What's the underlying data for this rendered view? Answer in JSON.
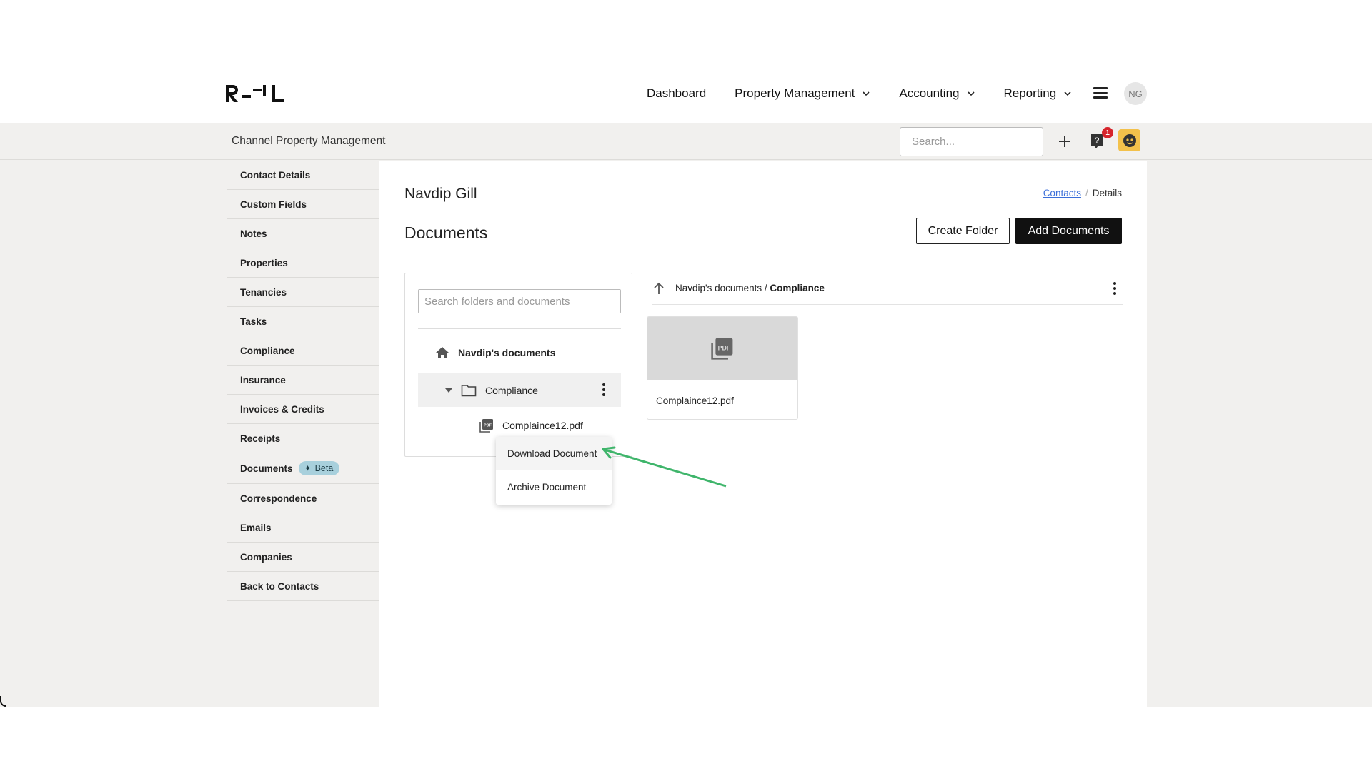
{
  "nav": {
    "links": [
      "Dashboard",
      "Property Management",
      "Accounting",
      "Reporting"
    ],
    "avatar_initials": "NG"
  },
  "subbar": {
    "company": "Channel Property Management",
    "search_placeholder": "Search...",
    "help_badge_count": "1"
  },
  "sidebar": {
    "items": [
      {
        "label": "Contact Details"
      },
      {
        "label": "Custom Fields"
      },
      {
        "label": "Notes"
      },
      {
        "label": "Properties"
      },
      {
        "label": "Tenancies"
      },
      {
        "label": "Tasks"
      },
      {
        "label": "Compliance"
      },
      {
        "label": "Insurance"
      },
      {
        "label": "Invoices & Credits"
      },
      {
        "label": "Receipts"
      },
      {
        "label": "Documents",
        "badge": "Beta"
      },
      {
        "label": "Correspondence"
      },
      {
        "label": "Emails"
      },
      {
        "label": "Companies"
      },
      {
        "label": "Back to Contacts"
      }
    ]
  },
  "main": {
    "contact_name": "Navdip Gill",
    "breadcrumb": {
      "link": "Contacts",
      "sep": "/",
      "current": "Details"
    },
    "section_title": "Documents",
    "create_folder_label": "Create Folder",
    "add_documents_label": "Add Documents"
  },
  "tree": {
    "search_placeholder": "Search folders and documents",
    "root_label": "Navdip's documents",
    "folder_label": "Compliance",
    "file_label": "Complaince12.pdf"
  },
  "context_menu": {
    "download_label": "Download Document",
    "archive_label": "Archive Document"
  },
  "pane": {
    "path_parent": "Navdip's documents",
    "path_sep": " / ",
    "path_current": "Compliance",
    "file_name": "Complaince12.pdf"
  },
  "colors": {
    "accent_dark": "#111111",
    "link": "#3b6fd9",
    "badge_red": "#d6242b",
    "assistant_yellow": "#f3c14b",
    "beta_bg": "#a8d0dc",
    "annotation_green": "#3fb56b"
  },
  "icons": [
    "chevron-down-icon",
    "menu-icon",
    "plus-icon",
    "help-icon",
    "assistant-icon",
    "home-icon",
    "caret-down-icon",
    "folder-icon",
    "pdf-icon",
    "kebab-icon",
    "arrow-up-icon",
    "sparkle-icon"
  ]
}
